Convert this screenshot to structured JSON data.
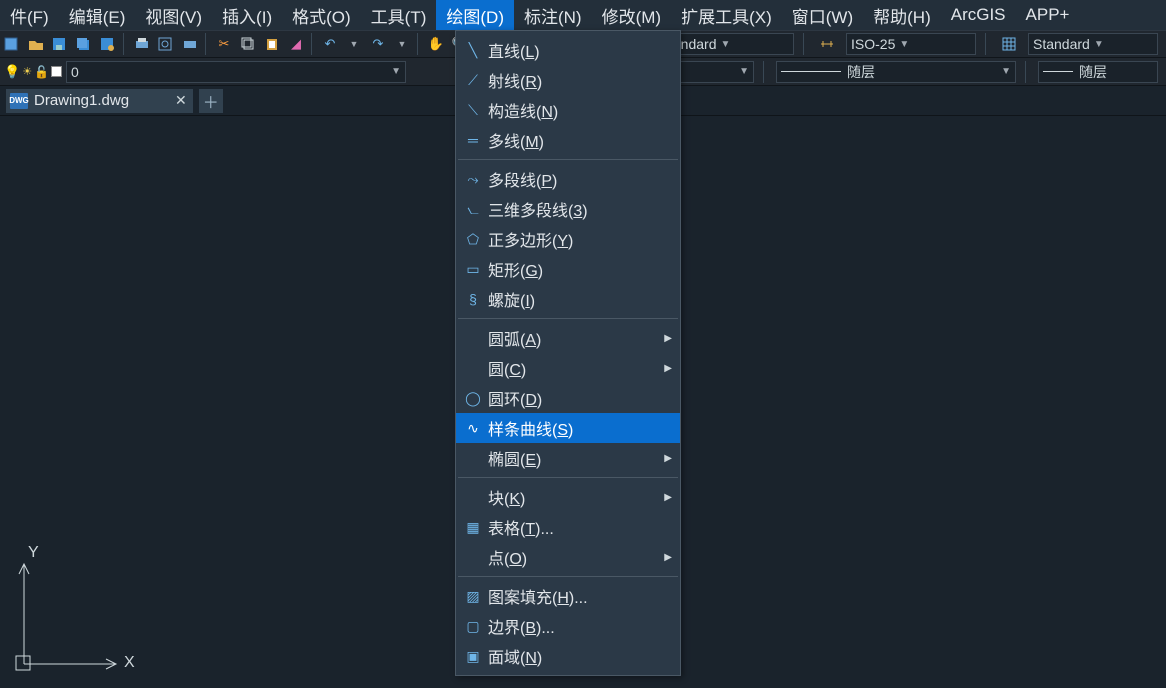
{
  "menubar": {
    "items": [
      {
        "label": "件(F)"
      },
      {
        "label": "编辑(E)"
      },
      {
        "label": "视图(V)"
      },
      {
        "label": "插入(I)"
      },
      {
        "label": "格式(O)"
      },
      {
        "label": "工具(T)"
      },
      {
        "label": "绘图(D)",
        "active": true
      },
      {
        "label": "标注(N)"
      },
      {
        "label": "修改(M)"
      },
      {
        "label": "扩展工具(X)"
      },
      {
        "label": "窗口(W)"
      },
      {
        "label": "帮助(H)"
      },
      {
        "label": "ArcGIS"
      },
      {
        "label": "APP+"
      }
    ]
  },
  "toolbar1": {
    "style_a": "tandard",
    "style_b": "ISO-25",
    "style_c": "Standard"
  },
  "toolbar2": {
    "layer_value": "0",
    "lisp_a": "随层",
    "lisp_b": "随层"
  },
  "doc": {
    "filename": "Drawing1.dwg"
  },
  "axis": {
    "x": "X",
    "y": "Y"
  },
  "menu": {
    "g1": [
      {
        "icon": "line",
        "label": "直线(",
        "u": "L",
        "tail": ")"
      },
      {
        "icon": "ray",
        "label": "射线(",
        "u": "R",
        "tail": ")"
      },
      {
        "icon": "xline",
        "label": "构造线(",
        "u": "N",
        "tail": ")"
      },
      {
        "icon": "mline",
        "label": "多线(",
        "u": "M",
        "tail": ")"
      }
    ],
    "g2": [
      {
        "icon": "pline",
        "label": "多段线(",
        "u": "P",
        "tail": ")"
      },
      {
        "icon": "3dpoly",
        "label": "三维多段线(",
        "u": "3",
        "tail": ")"
      },
      {
        "icon": "polygon",
        "label": "正多边形(",
        "u": "Y",
        "tail": ")"
      },
      {
        "icon": "rect",
        "label": "矩形(",
        "u": "G",
        "tail": ")"
      },
      {
        "icon": "helix",
        "label": "螺旋(",
        "u": "I",
        "tail": ")"
      }
    ],
    "g3": [
      {
        "icon": "",
        "label": "圆弧(",
        "u": "A",
        "tail": ")",
        "sub": true
      },
      {
        "icon": "",
        "label": "圆(",
        "u": "C",
        "tail": ")",
        "sub": true
      },
      {
        "icon": "donut",
        "label": "圆环(",
        "u": "D",
        "tail": ")"
      },
      {
        "icon": "spline",
        "label": "样条曲线(",
        "u": "S",
        "tail": ")",
        "hover": true
      },
      {
        "icon": "",
        "label": "椭圆(",
        "u": "E",
        "tail": ")",
        "sub": true
      }
    ],
    "g4": [
      {
        "icon": "",
        "label": "块(",
        "u": "K",
        "tail": ")",
        "sub": true
      },
      {
        "icon": "table",
        "label": "表格(",
        "u": "T",
        "tail": ")..."
      },
      {
        "icon": "",
        "label": "点(",
        "u": "O",
        "tail": ")",
        "sub": true
      }
    ],
    "g5": [
      {
        "icon": "hatch",
        "label": "图案填充(",
        "u": "H",
        "tail": ")..."
      },
      {
        "icon": "boundary",
        "label": "边界(",
        "u": "B",
        "tail": ")..."
      },
      {
        "icon": "region",
        "label": "面域(",
        "u": "N",
        "tail": ")"
      }
    ]
  }
}
